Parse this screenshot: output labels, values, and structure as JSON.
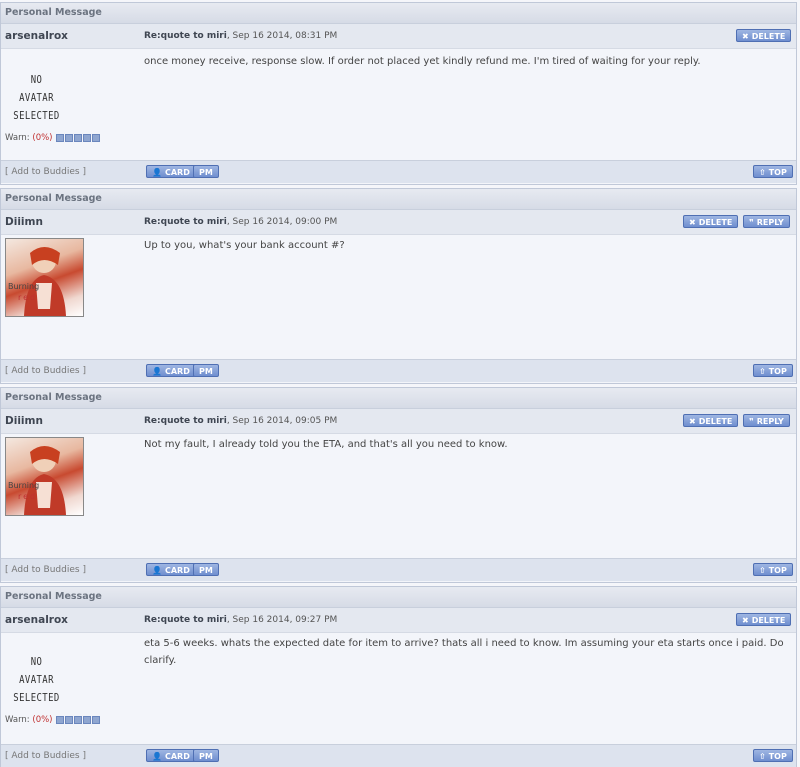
{
  "labels": {
    "header": "Personal Message",
    "add_buddies": "[ Add to Buddies ]",
    "delete": "DELETE",
    "reply": "REPLY",
    "card": "CARD",
    "pm": "PM",
    "top": "TOP",
    "no_avatar_1": "NO AVATAR",
    "no_avatar_2": "SELECTED",
    "warn_label": "Warn:",
    "avatar_text_1": "Burning",
    "avatar_text_2": "red"
  },
  "messages": [
    {
      "author": "arsenalrox",
      "subject": "Re:quote to miri",
      "date": ", Sep 16 2014, 08:31 PM",
      "body": "once money receive, response slow. If order not placed yet kindly refund me. I'm tired of waiting for your reply.",
      "warn_percent": "(0%)"
    },
    {
      "author": "Diiimn",
      "subject": "Re:quote to miri",
      "date": ", Sep 16 2014, 09:00 PM",
      "body": "Up to you, what's your bank account #?"
    },
    {
      "author": "Diiimn",
      "subject": "Re:quote to miri",
      "date": ", Sep 16 2014, 09:05 PM",
      "body": "Not my fault, I already told you the ETA, and that's all you need to know."
    },
    {
      "author": "arsenalrox",
      "subject": "Re:quote to miri",
      "date": ", Sep 16 2014, 09:27 PM",
      "body": "eta 5-6 weeks. whats the expected date for item to arrive? thats all i need to know. Im assuming your eta starts once i paid. Do clarify.",
      "warn_percent": "(0%)"
    }
  ]
}
